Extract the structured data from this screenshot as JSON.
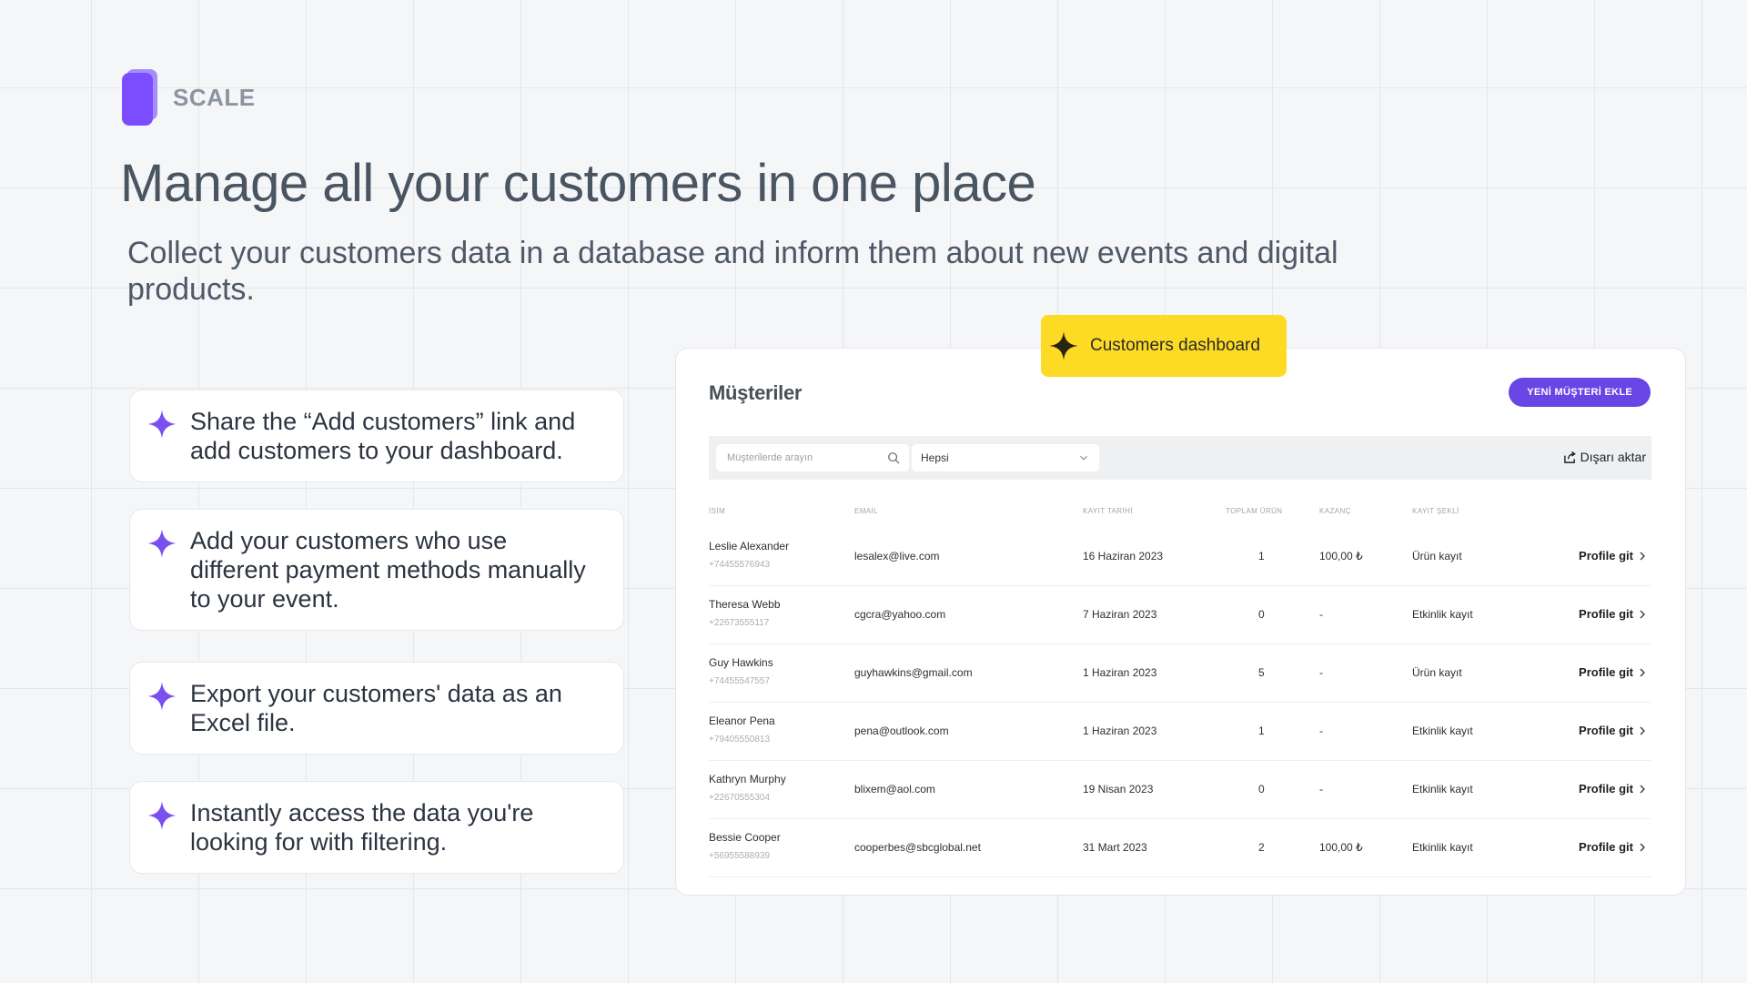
{
  "brand": {
    "name": "SCALE"
  },
  "hero": {
    "title": "Manage all your customers in one place",
    "subtitle": "Collect your customers data in a database and inform them about new events and digital products."
  },
  "features": [
    {
      "icon": "sparkle-icon",
      "text": "Share the “Add customers” link and add customers to your dashboard."
    },
    {
      "icon": "sparkle-icon",
      "text": "Add your customers who use different payment methods manually to your event."
    },
    {
      "icon": "sparkle-icon",
      "text": "Export your customers' data as an Excel file."
    },
    {
      "icon": "sparkle-icon",
      "text": "Instantly access the data you're looking for with filtering."
    }
  ],
  "badge": {
    "icon": "sparkle-icon",
    "label": "Customers dashboard"
  },
  "dashboard": {
    "title": "Müşteriler",
    "add_button": "YENİ MÜŞTERİ EKLE",
    "search_placeholder": "Müşterilerde arayın",
    "filter_value": "Hepsi",
    "export_label": "Dışarı aktar",
    "columns": [
      "İSİM",
      "EMAİL",
      "KAYIT TARİHİ",
      "TOPLAM ÜRÜN",
      "KAZANÇ",
      "KAYIT ŞEKLİ"
    ],
    "rows": [
      {
        "name": "Leslie Alexander",
        "phone": "+74455576943",
        "email": "lesalex@live.com",
        "date": "16 Haziran 2023",
        "total": "1",
        "earning": "100,00 ₺",
        "type": "Ürün kayıt",
        "action": "Profile git"
      },
      {
        "name": "Theresa Webb",
        "phone": "+22673555117",
        "email": "cgcra@yahoo.com",
        "date": "7 Haziran 2023",
        "total": "0",
        "earning": "-",
        "type": "Etkinlik kayıt",
        "action": "Profile git"
      },
      {
        "name": "Guy Hawkins",
        "phone": "+74455547557",
        "email": "guyhawkins@gmail.com",
        "date": "1 Haziran 2023",
        "total": "5",
        "earning": "-",
        "type": "Ürün kayıt",
        "action": "Profile git"
      },
      {
        "name": "Eleanor Pena",
        "phone": "+79405550813",
        "email": "pena@outlook.com",
        "date": "1 Haziran 2023",
        "total": "1",
        "earning": "-",
        "type": "Etkinlik kayıt",
        "action": "Profile git"
      },
      {
        "name": "Kathryn Murphy",
        "phone": "+22670555304",
        "email": "blixem@aol.com",
        "date": "19 Nisan 2023",
        "total": "0",
        "earning": "-",
        "type": "Etkinlik kayıt",
        "action": "Profile git"
      },
      {
        "name": "Bessie Cooper",
        "phone": "+56955588939",
        "email": "cooperbes@sbcglobal.net",
        "date": "31 Mart 2023",
        "total": "2",
        "earning": "100,00 ₺",
        "type": "Etkinlik kayıt",
        "action": "Profile git"
      }
    ]
  },
  "colors": {
    "accent": "#7c4dff",
    "button": "#6a45e6",
    "badge": "#fddb24",
    "sparkle": "#7a4ff0"
  }
}
